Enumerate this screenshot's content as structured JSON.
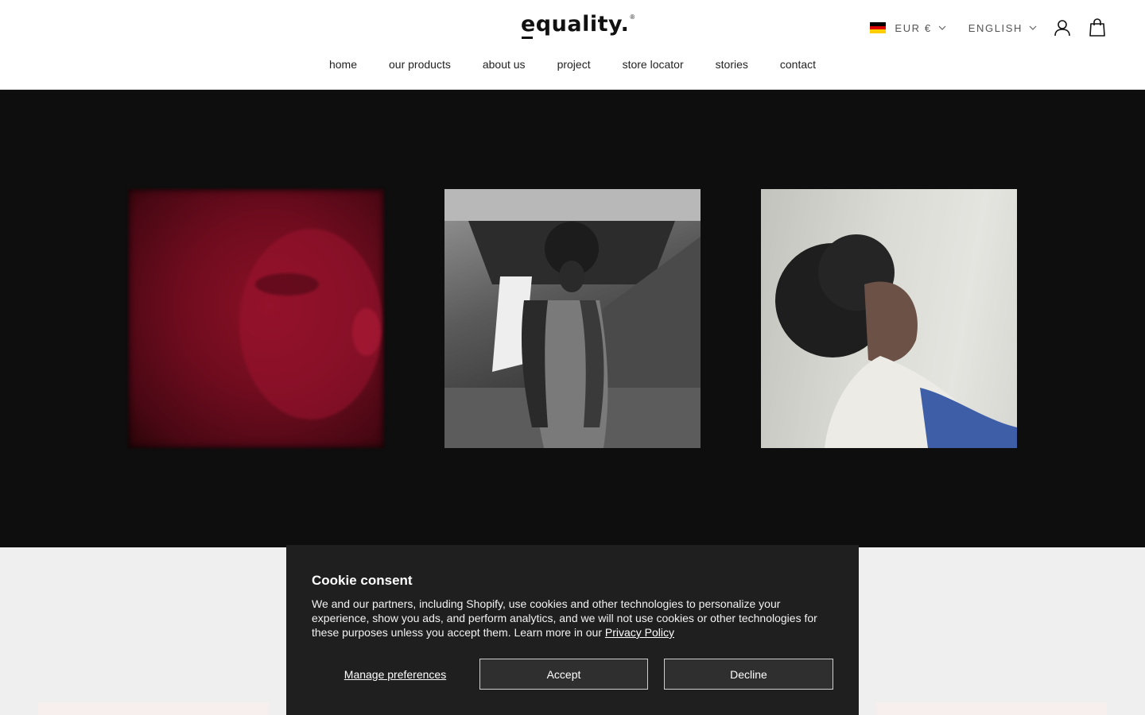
{
  "brand": {
    "name": "equality.",
    "reg": "®"
  },
  "header": {
    "currency": "EUR €",
    "language": "ENGLISH",
    "flag_colors": [
      "#000000",
      "#DD0000",
      "#FFCE00"
    ],
    "icons": [
      "account-icon",
      "cart-icon"
    ]
  },
  "nav": {
    "items": [
      {
        "label": "home"
      },
      {
        "label": "our products"
      },
      {
        "label": "about us"
      },
      {
        "label": "project"
      },
      {
        "label": "store locator"
      },
      {
        "label": "stories"
      },
      {
        "label": "contact"
      }
    ]
  },
  "hero": {
    "background": "#0e0e0e",
    "images": [
      "red-portrait-image",
      "black-white-portrait-image",
      "portrait-by-window-image"
    ]
  },
  "cookie": {
    "title": "Cookie consent",
    "body": "We and our partners, including Shopify, use cookies and other technologies to personalize your experience, show you ads, and perform analytics, and we will not use cookies or other technologies for these purposes unless you accept them. Learn more in our ",
    "link": "Privacy Policy",
    "manage": "Manage preferences",
    "accept": "Accept",
    "decline": "Decline"
  }
}
